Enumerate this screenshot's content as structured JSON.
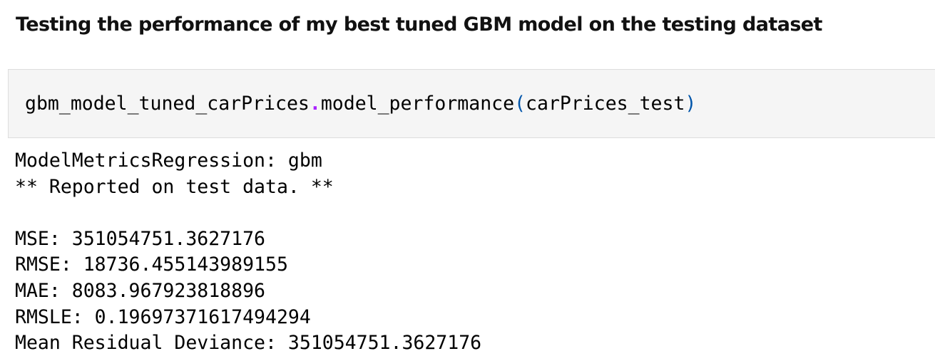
{
  "heading": "Testing the performance of my best tuned GBM model on the testing dataset",
  "code_cell": {
    "object": "gbm_model_tuned_carPrices",
    "dot": ".",
    "method": "model_performance",
    "open_paren": "(",
    "argument": "carPrices_test",
    "close_paren": ")"
  },
  "output": {
    "line1": "ModelMetricsRegression: gbm",
    "line2": "** Reported on test data. **",
    "mse": "MSE: 351054751.3627176",
    "rmse": "RMSE: 18736.455143989155",
    "mae": "MAE: 8083.967923818896",
    "rmsle": "RMSLE: 0.19697371617494294",
    "mrd": "Mean Residual Deviance: 351054751.3627176"
  },
  "colors": {
    "dot_operator": "#aa22ff",
    "parenthesis": "#0055aa",
    "cell_background": "#f5f5f5"
  }
}
